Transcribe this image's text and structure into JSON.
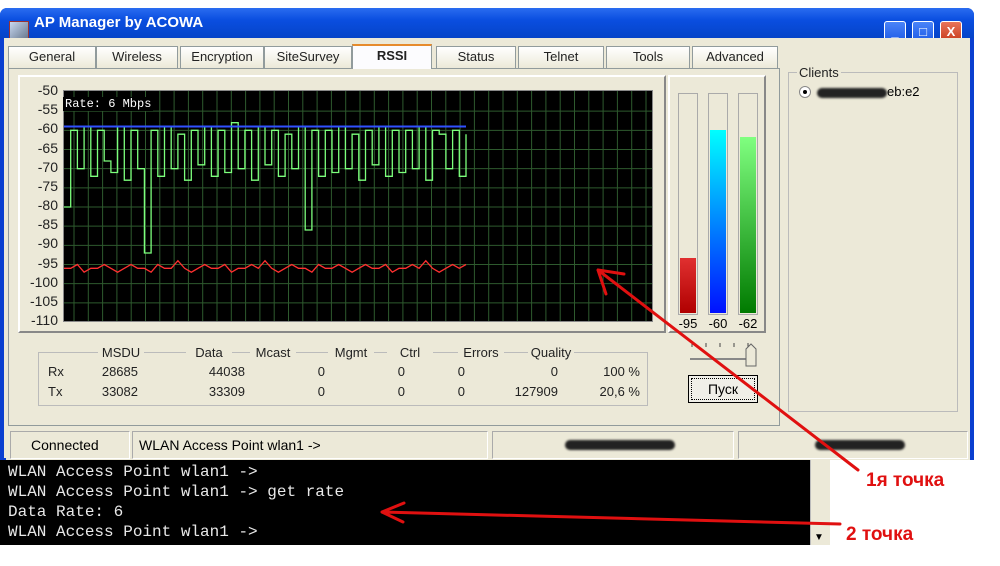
{
  "window": {
    "title": "AP Manager by ACOWA",
    "buttons": [
      "_",
      "□",
      "X"
    ]
  },
  "tabs": [
    {
      "label": "General"
    },
    {
      "label": "Wireless"
    },
    {
      "label": "Encryption"
    },
    {
      "label": "SiteSurvey"
    },
    {
      "label": "RSSI",
      "active": true
    },
    {
      "label": "Status"
    },
    {
      "label": "Telnet"
    },
    {
      "label": "Tools"
    },
    {
      "label": "Advanced"
    }
  ],
  "rssi": {
    "rate_label": "Rate:     6 Mbps",
    "y_ticks": [
      "-50",
      "-55",
      "-60",
      "-65",
      "-70",
      "-75",
      "-80",
      "-85",
      "-90",
      "-95",
      "-100",
      "-105",
      "-110"
    ],
    "ylim": [
      -110,
      -50
    ],
    "series": {
      "noise_color": "#ff3030",
      "signal_color": "#7cff7c",
      "avg_color": "#3050ff",
      "signal": [
        -80,
        -60,
        -70,
        -59,
        -72,
        -60,
        -68,
        -71,
        -59,
        -73,
        -60,
        -70,
        -92,
        -60,
        -72,
        -59,
        -70,
        -61,
        -73,
        -60,
        -69,
        -59,
        -72,
        -60,
        -71,
        -58,
        -70,
        -60,
        -73,
        -59,
        -69,
        -60,
        -72,
        -61,
        -70,
        -59,
        -86,
        -60,
        -72,
        -60,
        -71,
        -59,
        -70,
        -61,
        -73,
        -60,
        -69,
        -59,
        -72,
        -60,
        -71,
        -60,
        -70,
        -59,
        -73,
        -60,
        -61,
        -70,
        -60,
        -72,
        -61
      ],
      "avg": -59,
      "noise": [
        -96,
        -96,
        -95,
        -97,
        -96,
        -96,
        -95,
        -96,
        -97,
        -96,
        -95,
        -96,
        -96,
        -97,
        -95,
        -96,
        -96,
        -94,
        -96,
        -97,
        -96,
        -95,
        -96,
        -96,
        -95,
        -97,
        -96,
        -96,
        -95,
        -96,
        -94,
        -96,
        -97,
        -96,
        -95,
        -96,
        -96,
        -97,
        -95,
        -96,
        -96,
        -95,
        -96,
        -97,
        -96,
        -95,
        -96,
        -96,
        -95,
        -97,
        -96,
        -96,
        -95,
        -96,
        -94,
        -96,
        -97,
        -96,
        -95,
        -96,
        -95
      ]
    },
    "meters": [
      {
        "value": "-95",
        "level": -95,
        "colors": [
          "#e03030",
          "#b00000"
        ]
      },
      {
        "value": "-60",
        "level": -60,
        "colors": [
          "#00ffff",
          "#0010ff"
        ]
      },
      {
        "value": "-62",
        "level": -62,
        "colors": [
          "#80ff80",
          "#007a00"
        ]
      }
    ],
    "start_button": "Пуск"
  },
  "stats": {
    "headers": [
      "MSDU",
      "Data",
      "Mcast",
      "Mgmt",
      "Ctrl",
      "Errors",
      "Quality"
    ],
    "rows": [
      {
        "label": "Rx",
        "values": [
          "28685",
          "44038",
          "0",
          "0",
          "0",
          "0",
          "100 %"
        ]
      },
      {
        "label": "Tx",
        "values": [
          "33082",
          "33309",
          "0",
          "0",
          "0",
          "127909",
          "20,6 %"
        ]
      }
    ]
  },
  "clients": {
    "legend": "Clients",
    "items": [
      {
        "mac_suffix": "eb:e2",
        "selected": true
      }
    ]
  },
  "statusbar": {
    "state": "Connected",
    "prompt": "WLAN Access Point wlan1 ->"
  },
  "console": {
    "lines": [
      "WLAN Access Point wlan1 ->",
      "WLAN Access Point wlan1 -> get rate",
      "Data Rate: 6",
      "WLAN Access Point wlan1 ->"
    ]
  },
  "annotations": {
    "point1": "1я точка",
    "point2": "2 точка",
    "color": "#e01010"
  }
}
